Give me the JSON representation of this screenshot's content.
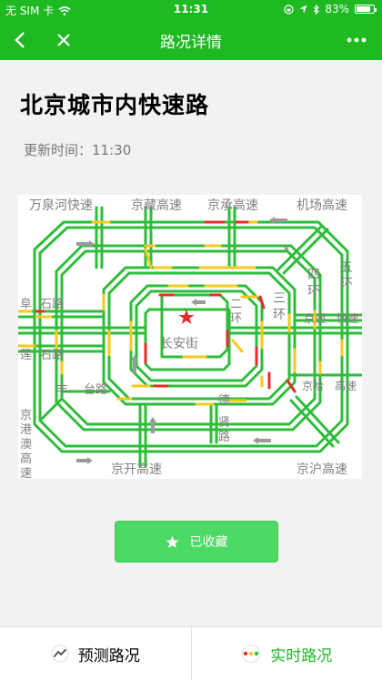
{
  "status_bar": {
    "carrier": "无 SIM 卡",
    "time": "11:31",
    "battery_text": "83%",
    "battery_level": 0.83
  },
  "nav": {
    "title": "路况详情"
  },
  "page": {
    "title": "北京城市内快速路",
    "update_label": "更新时间：",
    "update_time": "11:30"
  },
  "map": {
    "labels": {
      "wanquanhe": "万泉河快速",
      "jingzang": "京藏高速",
      "jingcheng": "京承高速",
      "jichang": "机场高速",
      "fucheng_fu": "阜",
      "fucheng_road": "石路",
      "lian": "莲",
      "lian_road": "石路",
      "feng": "丰",
      "feng_road": "台路",
      "jinggang": [
        "京",
        "港",
        "澳",
        "高",
        "速"
      ],
      "jingkai": "京开高速",
      "jinghu": "京沪高速",
      "deshengmen_de": "德",
      "xianlu": [
        "贤",
        "路"
      ],
      "changan": "长安街",
      "er_ring": [
        "二",
        "环"
      ],
      "san_ring": [
        "三",
        "环"
      ],
      "si_ring": [
        "四",
        "环"
      ],
      "wu_ring": [
        "五",
        "环"
      ],
      "jingtong": "京通",
      "kuaisu": "快速",
      "jingha": "京哈",
      "gaosu": "高速"
    },
    "colors": {
      "green": "#2ebd3a",
      "yellow": "#f7c91c",
      "red": "#e82b2b",
      "label": "#808080"
    }
  },
  "collect_button": {
    "label": "已收藏"
  },
  "tabs": [
    {
      "label": "预测路况",
      "active": false
    },
    {
      "label": "实时路况",
      "active": true
    }
  ]
}
